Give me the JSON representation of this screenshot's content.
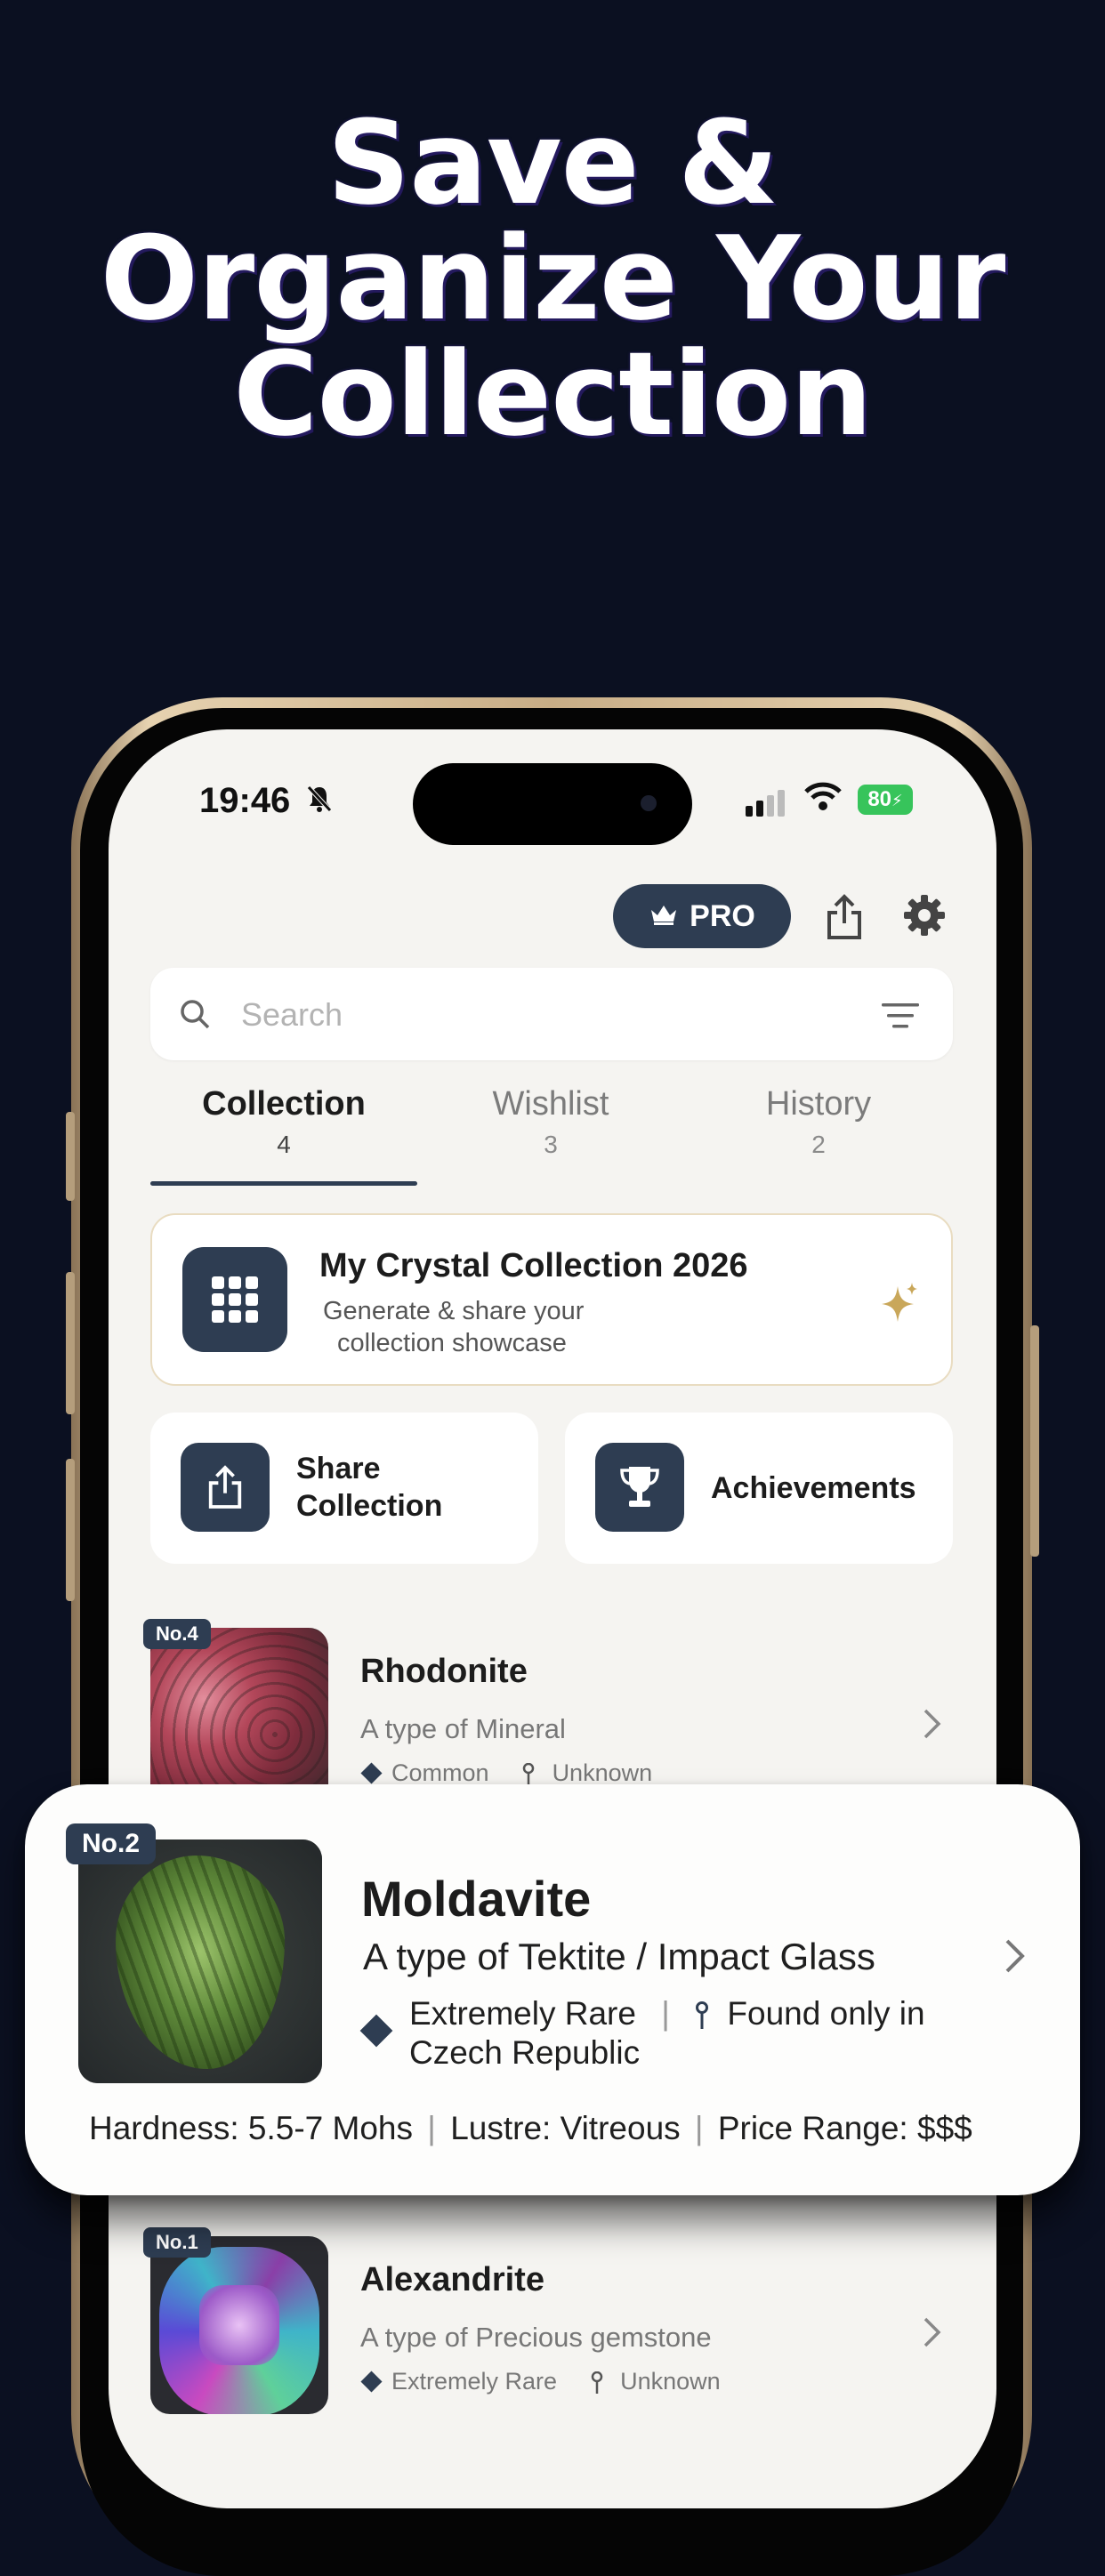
{
  "headline": {
    "line1": "Save &",
    "line2": "Organize Your",
    "line3": "Collection"
  },
  "status_bar": {
    "time": "19:46",
    "battery": "80"
  },
  "header": {
    "pro_label": "PRO"
  },
  "search": {
    "placeholder": "Search"
  },
  "tabs": [
    {
      "label": "Collection",
      "count": "4"
    },
    {
      "label": "Wishlist",
      "count": "3"
    },
    {
      "label": "History",
      "count": "2"
    }
  ],
  "showcase_card": {
    "title": "My Crystal Collection 2026",
    "subtitle_line1": "Generate & share your",
    "subtitle_line2": "collection showcase"
  },
  "quick_actions": {
    "share_line1": "Share",
    "share_line2": "Collection",
    "achievements": "Achievements"
  },
  "collection_items": [
    {
      "badge": "No.4",
      "name": "Rhodonite",
      "type": "A type of Mineral",
      "rarity": "Common",
      "location": "Unknown"
    },
    {
      "badge": "No.1",
      "name": "Alexandrite",
      "type": "A type of Precious gemstone",
      "rarity": "Extremely Rare",
      "location": "Unknown"
    }
  ],
  "featured_item": {
    "badge": "No.2",
    "name": "Moldavite",
    "type": "A type of Tektite / Impact Glass",
    "rarity": "Extremely Rare",
    "location_line1": "Found only in",
    "location_line2": "Czech Republic",
    "hardness": "Hardness: 5.5-7 Mohs",
    "lustre": "Lustre: Vitreous",
    "price": "Price Range: $$$"
  },
  "colors": {
    "background": "#0b1021",
    "accent": "#2e3d52",
    "battery": "#37c45b",
    "gold": "#c9a75a"
  }
}
